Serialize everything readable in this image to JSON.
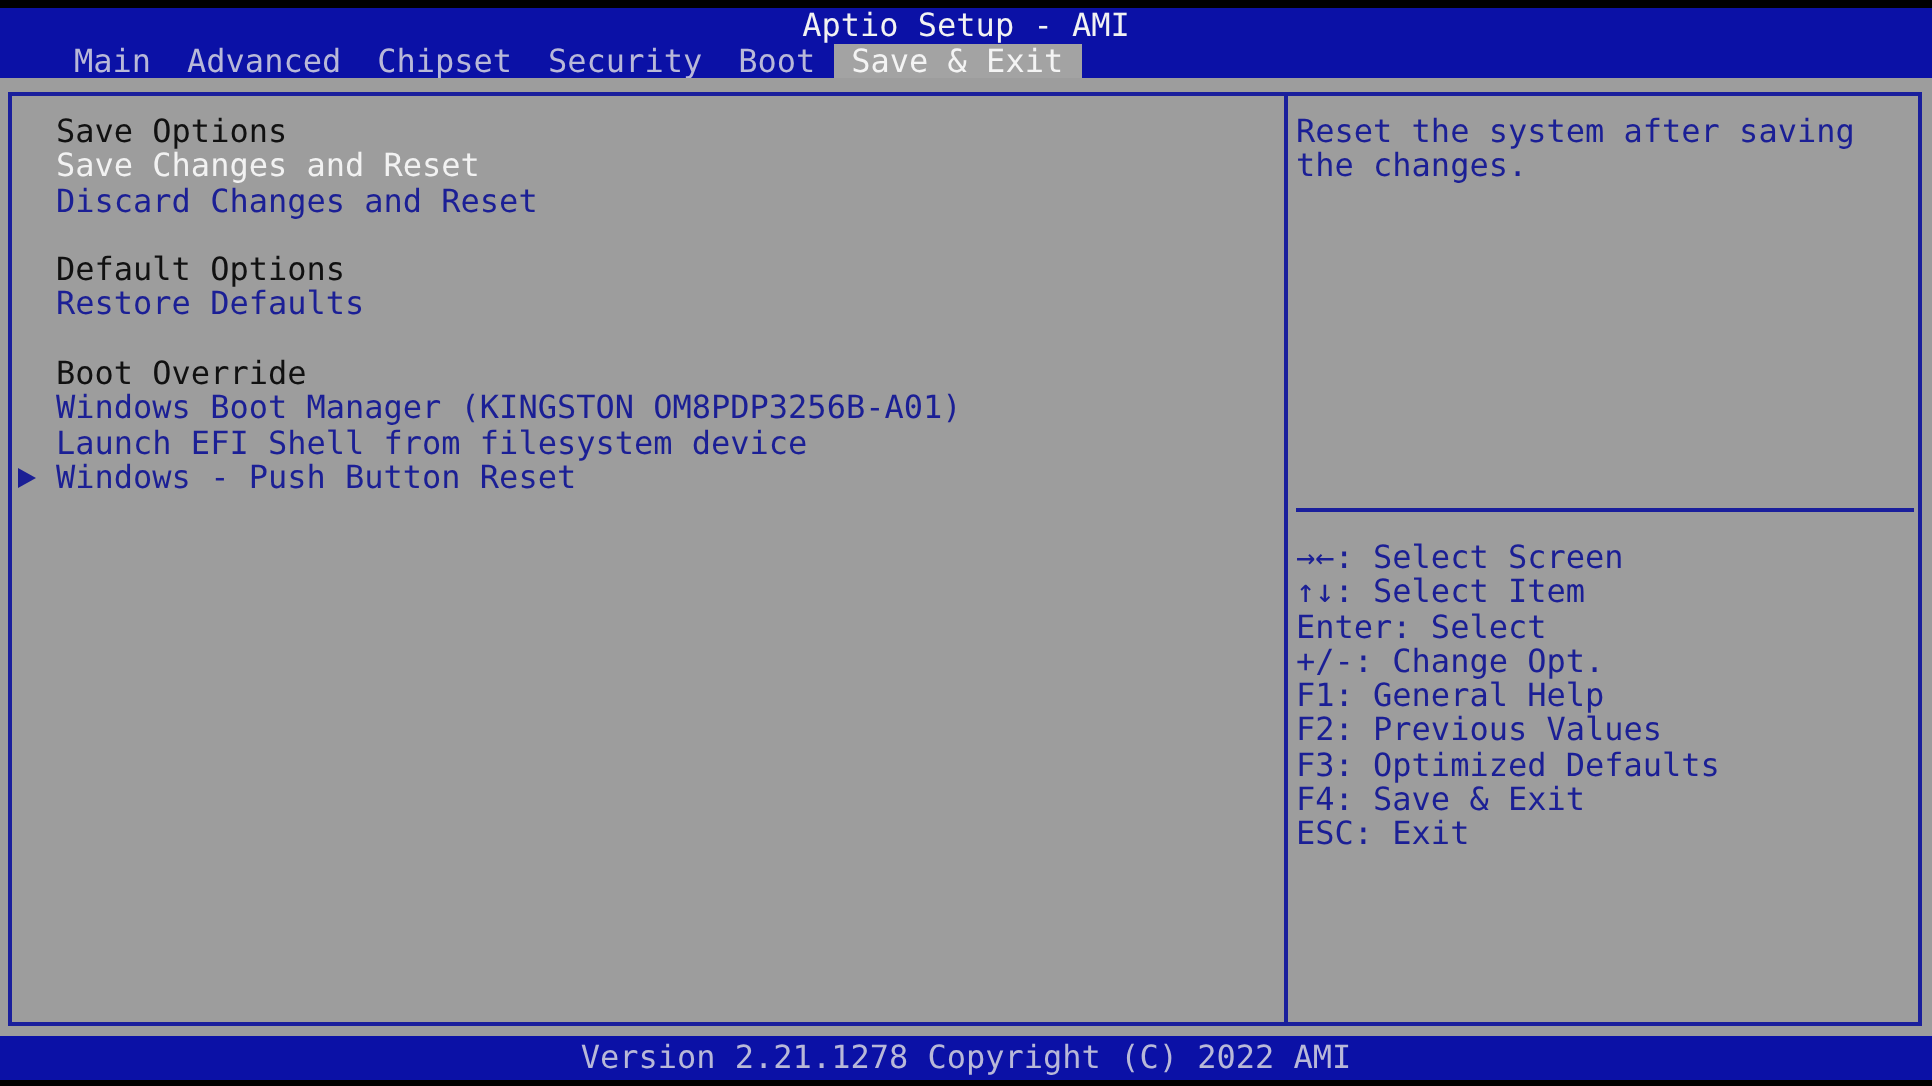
{
  "window": {
    "title": "Aptio Setup - AMI"
  },
  "tabs": [
    {
      "label": "Main",
      "selected": false
    },
    {
      "label": "Advanced",
      "selected": false
    },
    {
      "label": "Chipset",
      "selected": false
    },
    {
      "label": "Security",
      "selected": false
    },
    {
      "label": "Boot",
      "selected": false
    },
    {
      "label": "Save & Exit",
      "selected": true
    }
  ],
  "sections": [
    {
      "title": "Save Options",
      "items": [
        {
          "label": "Save Changes and Reset",
          "selected": true,
          "submenu": false
        },
        {
          "label": "Discard Changes and Reset",
          "selected": false,
          "submenu": false
        }
      ]
    },
    {
      "title": "Default Options",
      "items": [
        {
          "label": "Restore Defaults",
          "selected": false,
          "submenu": false
        }
      ]
    },
    {
      "title": "Boot Override",
      "items": [
        {
          "label": "Windows Boot Manager (KINGSTON OM8PDP3256B-A01)",
          "selected": false,
          "submenu": false
        },
        {
          "label": "Launch EFI Shell from filesystem device",
          "selected": false,
          "submenu": false
        },
        {
          "label": "Windows - Push Button Reset",
          "selected": false,
          "submenu": true
        }
      ]
    }
  ],
  "help": {
    "description": "Reset the system after saving the changes.",
    "keys": [
      "→←: Select Screen",
      "↑↓: Select Item",
      "Enter: Select",
      "+/-: Change Opt.",
      "F1: General Help",
      "F2: Previous Values",
      "F3: Optimized Defaults",
      "F4: Save & Exit",
      "ESC: Exit"
    ]
  },
  "status_bar": "Version 2.21.1278 Copyright (C) 2022 AMI"
}
